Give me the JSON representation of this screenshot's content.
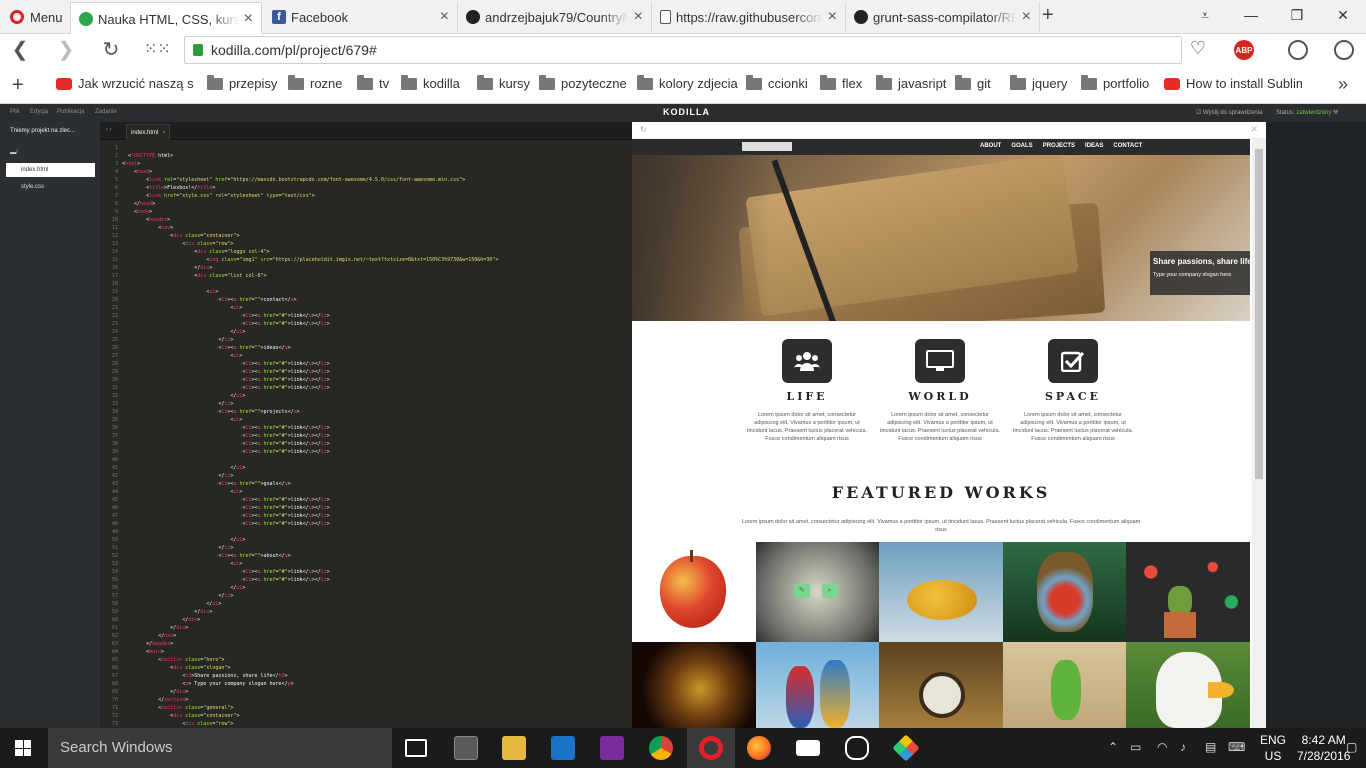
{
  "browser": {
    "menu_label": "Menu",
    "tabs": [
      {
        "title": "Nauka HTML, CSS, kurs on",
        "active": true
      },
      {
        "title": "Facebook",
        "active": false
      },
      {
        "title": "andrzejbajuk79/CountryNa",
        "active": false
      },
      {
        "title": "https://raw.githubuserconte",
        "active": false
      },
      {
        "title": "grunt-sass-compilator/REA",
        "active": false
      }
    ],
    "url": "kodilla.com/pl/project/679#",
    "abp_label": "ABP",
    "bookmarks": [
      {
        "label": "Jak wrzucić naszą stro",
        "icon": "youtube-icon"
      },
      {
        "label": "przepisy",
        "icon": "folder-icon"
      },
      {
        "label": "rozne",
        "icon": "folder-icon"
      },
      {
        "label": "tv",
        "icon": "folder-icon"
      },
      {
        "label": "kodilla",
        "icon": "folder-icon"
      },
      {
        "label": "kursy",
        "icon": "folder-icon"
      },
      {
        "label": "pozyteczne",
        "icon": "folder-icon"
      },
      {
        "label": "kolory zdjecia",
        "icon": "folder-icon"
      },
      {
        "label": "ccionki",
        "icon": "folder-icon"
      },
      {
        "label": "flex",
        "icon": "folder-icon"
      },
      {
        "label": "javasript",
        "icon": "folder-icon"
      },
      {
        "label": "git",
        "icon": "folder-icon"
      },
      {
        "label": "jquery",
        "icon": "folder-icon"
      },
      {
        "label": "portfolio",
        "icon": "folder-icon"
      },
      {
        "label": "How to install Sublim",
        "icon": "youtube-icon"
      }
    ]
  },
  "app": {
    "menu": [
      "Plik",
      "Edycja",
      "Publikacja",
      "Zadanie"
    ],
    "logo": "KODILLA",
    "send_label": "Wyślij do sprawdzenia",
    "status_label": "Status:",
    "status_value": "zatwierdzony",
    "project_title": "Tniemy projekt na zlec...",
    "tree_root": "/",
    "files": [
      "index.html",
      "style.css"
    ],
    "editor_tab": "index.html",
    "code": [
      "",
      "  <!DOCTYPE html>",
      "<html>",
      "    <head>",
      "        <link rel=\"stylesheet\" href=\"https://maxcdn.bootstrapcdn.com/font-awesome/4.5.0/css/font-awesome.min.css\">",
      "        <title>Flexbox!</title>",
      "        <link href=\"style.css\" rel=\"stylesheet\" type=\"text/css\">",
      "    </head>",
      "    <body>",
      "        <header>",
      "            <nav>",
      "                <div class=\"container\">",
      "                    <div class=\"row\">",
      "                        <div class=\"loggo col-4\">",
      "                            <img class=\"img1\" src=\"https://placeholdit.imgix.net/~text?txtsize=8&txt=150%C3%9730&w=150&h=30\">",
      "                        </div>",
      "                        <div class=\"list col-8\">",
      "",
      "                            <ul>",
      "                                <li><a href=\"\">contact</a>",
      "                                    <ul>",
      "                                        <li><a href=\"#\">link</a></li>",
      "                                        <li><a href=\"#\">link</a></li>",
      "                                    </ul>",
      "                                </li>",
      "                                <li><a href=\"\">ideas</a>",
      "                                    <ul>",
      "                                        <li><a href=\"#\">link</a></li>",
      "                                        <li><a href=\"#\">link</a></li>",
      "                                        <li><a href=\"#\">link</a></li>",
      "                                        <li><a href=\"#\">link</a></li>",
      "                                    </ul>",
      "                                </li>",
      "                                <li><a href=\"\">projects</a>",
      "                                    <ul>",
      "                                        <li><a href=\"#\">link</a></li>",
      "                                        <li><a href=\"#\">link</a></li>",
      "                                        <li><a href=\"#\">link</a></li>",
      "                                        <li><a href=\"#\">link</a></li>",
      "",
      "                                    </ul>",
      "                                </li>",
      "                                <li><a href=\"\">goals</a>",
      "                                    <ul>",
      "                                        <li><a href=\"#\">link</a></li>",
      "                                        <li><a href=\"#\">link</a></li>",
      "                                        <li><a href=\"#\">link</a></li>",
      "                                        <li><a href=\"#\">link</a></li>",
      "",
      "                                    </ul>",
      "                                </li>",
      "                                <li><a href=\"\">about</a>",
      "                                    <ul>",
      "                                        <li><a href=\"#\">link</a></li>",
      "                                        <li><a href=\"#\">link</a></li>",
      "                                    </ul>",
      "                                </li>",
      "                            </ul>",
      "                        </div>",
      "                    </div>",
      "                </div>",
      "            </nav>",
      "        </header>",
      "        <main>",
      "            <section class=\"hero\">",
      "                <div class=\"slogan\">",
      "                    <h3>Share passions, share life</h3>",
      "                    <p> Type your company slogan here</p>",
      "                </div>",
      "            </section>",
      "            <section class=\"general\">",
      "                <div class=\"container\">",
      "                    <div class=\"row\">"
    ]
  },
  "site": {
    "nav": [
      "ABOUT",
      "GOALS",
      "PROJECTS",
      "IDEAS",
      "CONTACT"
    ],
    "slogan_title": "Share passions, share life",
    "slogan_sub": "Type your company slogan here",
    "features": [
      {
        "title": "LIFE",
        "icon": "users-icon",
        "text": "Lorem ipsum dolor sit amet, consectetur adipiscing elit. Vivamus a porttitor ipsum, ut tincidunt lacus. Praesent luctus placerat vehicula. Fusce condimentum aliquam risus"
      },
      {
        "title": "WORLD",
        "icon": "monitor-icon",
        "text": "Lorem ipsum dolor sit amet, consectetur adipiscing elit. Vivamus a porttitor ipsum, ut tincidunt lacus. Praesent luctus placerat vehicula. Fusce condimentum aliquam risus"
      },
      {
        "title": "SPACE",
        "icon": "checkbox-icon",
        "text": "Lorem ipsum dolor sit amet, consectetur adipiscing elit. Vivamus a porttitor ipsum, ut tincidunt lacus. Praesent luctus placerat vehicula. Fusce condimentum aliquam risus"
      }
    ],
    "works_title": "FEATURED WORKS",
    "works_text": "Lorem ipsum dolor sit amet, consectetur adipiscing elit. Vivamus a porttitor ipsum, ut tincidunt lacus. Praesent luctus placerat vehicula. Fusce condimentum aliquam risus",
    "gallery": [
      "apple",
      "flower",
      "ladybug",
      "mandrill",
      "cactus",
      "saxophone",
      "parrots",
      "pocket-watch",
      "frog-toy",
      "eagle"
    ]
  },
  "taskbar": {
    "search_placeholder": "Search Windows",
    "lang_line1": "ENG",
    "lang_line2": "US",
    "time": "8:42 AM",
    "date": "7/28/2016"
  }
}
